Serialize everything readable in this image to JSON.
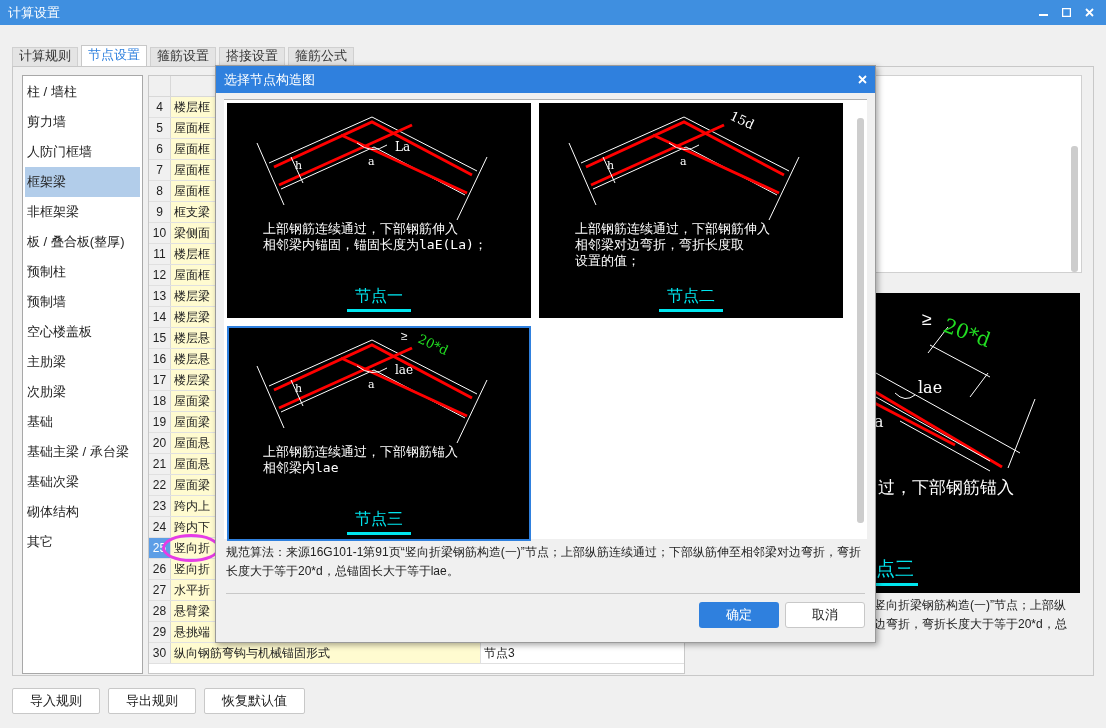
{
  "window": {
    "title": "计算设置"
  },
  "tabs": [
    {
      "label": "计算规则",
      "selected": false
    },
    {
      "label": "节点设置",
      "selected": true
    },
    {
      "label": "箍筋设置",
      "selected": false
    },
    {
      "label": "搭接设置",
      "selected": false
    },
    {
      "label": "箍筋公式",
      "selected": false
    }
  ],
  "categories": [
    {
      "label": "柱 / 墙柱",
      "selected": false
    },
    {
      "label": "剪力墙",
      "selected": false
    },
    {
      "label": "人防门框墙",
      "selected": false
    },
    {
      "label": "框架梁",
      "selected": true
    },
    {
      "label": "非框架梁",
      "selected": false
    },
    {
      "label": "板 / 叠合板(整厚)",
      "selected": false
    },
    {
      "label": "预制柱",
      "selected": false
    },
    {
      "label": "预制墙",
      "selected": false
    },
    {
      "label": "空心楼盖板",
      "selected": false
    },
    {
      "label": "主肋梁",
      "selected": false
    },
    {
      "label": "次肋梁",
      "selected": false
    },
    {
      "label": "基础",
      "selected": false
    },
    {
      "label": "基础主梁 / 承台梁",
      "selected": false
    },
    {
      "label": "基础次梁",
      "selected": false
    },
    {
      "label": "砌体结构",
      "selected": false
    },
    {
      "label": "其它",
      "selected": false
    }
  ],
  "table": {
    "rows": [
      {
        "number": "4",
        "name": "楼层框",
        "selected": false
      },
      {
        "number": "5",
        "name": "屋面框",
        "selected": false
      },
      {
        "number": "6",
        "name": "屋面框",
        "selected": false
      },
      {
        "number": "7",
        "name": "屋面框",
        "selected": false
      },
      {
        "number": "8",
        "name": "屋面框",
        "selected": false
      },
      {
        "number": "9",
        "name": "框支梁",
        "selected": false
      },
      {
        "number": "10",
        "name": "梁侧面",
        "selected": false
      },
      {
        "number": "11",
        "name": "楼层框",
        "selected": false
      },
      {
        "number": "12",
        "name": "屋面框",
        "selected": false
      },
      {
        "number": "13",
        "name": "楼层梁",
        "selected": false
      },
      {
        "number": "14",
        "name": "楼层梁",
        "selected": false
      },
      {
        "number": "15",
        "name": "楼层悬",
        "selected": false
      },
      {
        "number": "16",
        "name": "楼层悬",
        "selected": false
      },
      {
        "number": "17",
        "name": "楼层梁",
        "selected": false
      },
      {
        "number": "18",
        "name": "屋面梁",
        "selected": false
      },
      {
        "number": "19",
        "name": "屋面梁",
        "selected": false
      },
      {
        "number": "20",
        "name": "屋面悬",
        "selected": false
      },
      {
        "number": "21",
        "name": "屋面悬",
        "selected": false
      },
      {
        "number": "22",
        "name": "屋面梁",
        "selected": false
      },
      {
        "number": "23",
        "name": "跨内上",
        "selected": false
      },
      {
        "number": "24",
        "name": "跨内下",
        "selected": false
      },
      {
        "number": "25",
        "name": "竖向折",
        "selected": true
      },
      {
        "number": "26",
        "name": "竖向折",
        "selected": false
      },
      {
        "number": "27",
        "name": "水平折",
        "selected": false
      },
      {
        "number": "28",
        "name": "悬臂梁",
        "selected": false
      },
      {
        "number": "29",
        "name": "悬挑端",
        "selected": false
      },
      {
        "number": "30",
        "name": "纵向钢筋弯钩与机械锚固形式",
        "value": "节点3",
        "selected": false
      }
    ]
  },
  "annotation_circle": true,
  "preview": {
    "bend_sign": "≥",
    "bend_label": "20*d",
    "anchor_label": "lae",
    "angle_label": "a",
    "line": "过，下部钢筋锚入",
    "caption": "点三",
    "description_lines": [
      "竖向折梁钢筋构造(一)”节点；上部纵",
      "边弯折，弯折长度大于等于20*d，总"
    ]
  },
  "bottom_buttons": [
    "导入规则",
    "导出规则",
    "恢复默认值"
  ],
  "dialog": {
    "title": "选择节点构造图",
    "nodes": [
      {
        "caption": "节点一",
        "selected": false,
        "h_label": "h",
        "angle_label": "a",
        "anchor_label": "La",
        "lines": [
          "上部钢筋连续通过，下部钢筋伸入",
          "相邻梁内锚固，锚固长度为laE(La)；"
        ]
      },
      {
        "caption": "节点二",
        "selected": false,
        "h_label": "h",
        "angle_label": "a",
        "bend_label": {
          "text": "15d",
          "color": "#ffffff"
        },
        "lines": [
          "上部钢筋连续通过，下部钢筋伸入",
          "相邻梁对边弯折，弯折长度取",
          "设置的值；"
        ]
      },
      {
        "caption": "节点三",
        "selected": true,
        "h_label": "h",
        "angle_label": "a",
        "anchor_label": "lae",
        "bend_label": {
          "sign": "≥",
          "text": "20*d",
          "color": "#22dd22"
        },
        "lines": [
          "上部钢筋连续通过，下部钢筋锚入",
          "相邻梁内lae"
        ]
      }
    ],
    "description": "规范算法：来源16G101-1第91页“竖向折梁钢筋构造(一)”节点；上部纵筋连续通过；下部纵筋伸至相邻梁对边弯折，弯折长度大于等于20*d，总锚固长大于等于lae。",
    "buttons": [
      {
        "label": "确定",
        "kind": "primary"
      },
      {
        "label": "取消",
        "kind": "secondary"
      }
    ]
  }
}
